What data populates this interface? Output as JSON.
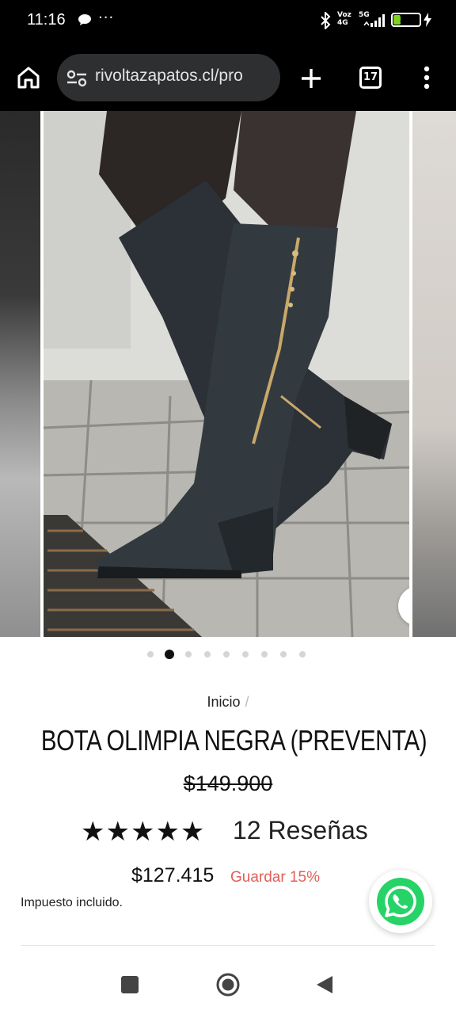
{
  "status_bar": {
    "time": "11:16",
    "more": "···",
    "voz_label": "Voz",
    "net_4g": "4G",
    "net_5g": "5G",
    "battery": "27",
    "battery_level": 0.27,
    "battery_color": "#7ed321"
  },
  "browser": {
    "url": "rivoltazapatos.cl/pro",
    "tab_count": "17",
    "icons": [
      "home-icon",
      "site-settings-icon",
      "plus-icon",
      "tab-switcher-icon",
      "kebab-menu-icon"
    ]
  },
  "carousel": {
    "slide_count": 9,
    "active_index": 1,
    "image_subject": "black knee-high boot with side zipper and block heel on cobblestone",
    "zoom_icon": "magnifier-icon"
  },
  "product": {
    "breadcrumb_home": "Inicio",
    "breadcrumb_sep": "/",
    "title": "BOTA OLIMPIA NEGRA (PREVENTA)",
    "old_price": "$149.900",
    "stars": "★★★★★",
    "rating_value": 5,
    "reviews": "12 Reseñas",
    "price": "$127.415",
    "save": "Guardar 15%",
    "tax_note": "Impuesto incluido."
  },
  "colors": {
    "save_badge": "#e0605a",
    "whatsapp": "#25d366"
  },
  "floating": {
    "icon": "whatsapp-icon"
  },
  "nav_bar": {
    "icons": [
      "recent-apps-icon",
      "home-circle-icon",
      "back-triangle-icon"
    ]
  }
}
